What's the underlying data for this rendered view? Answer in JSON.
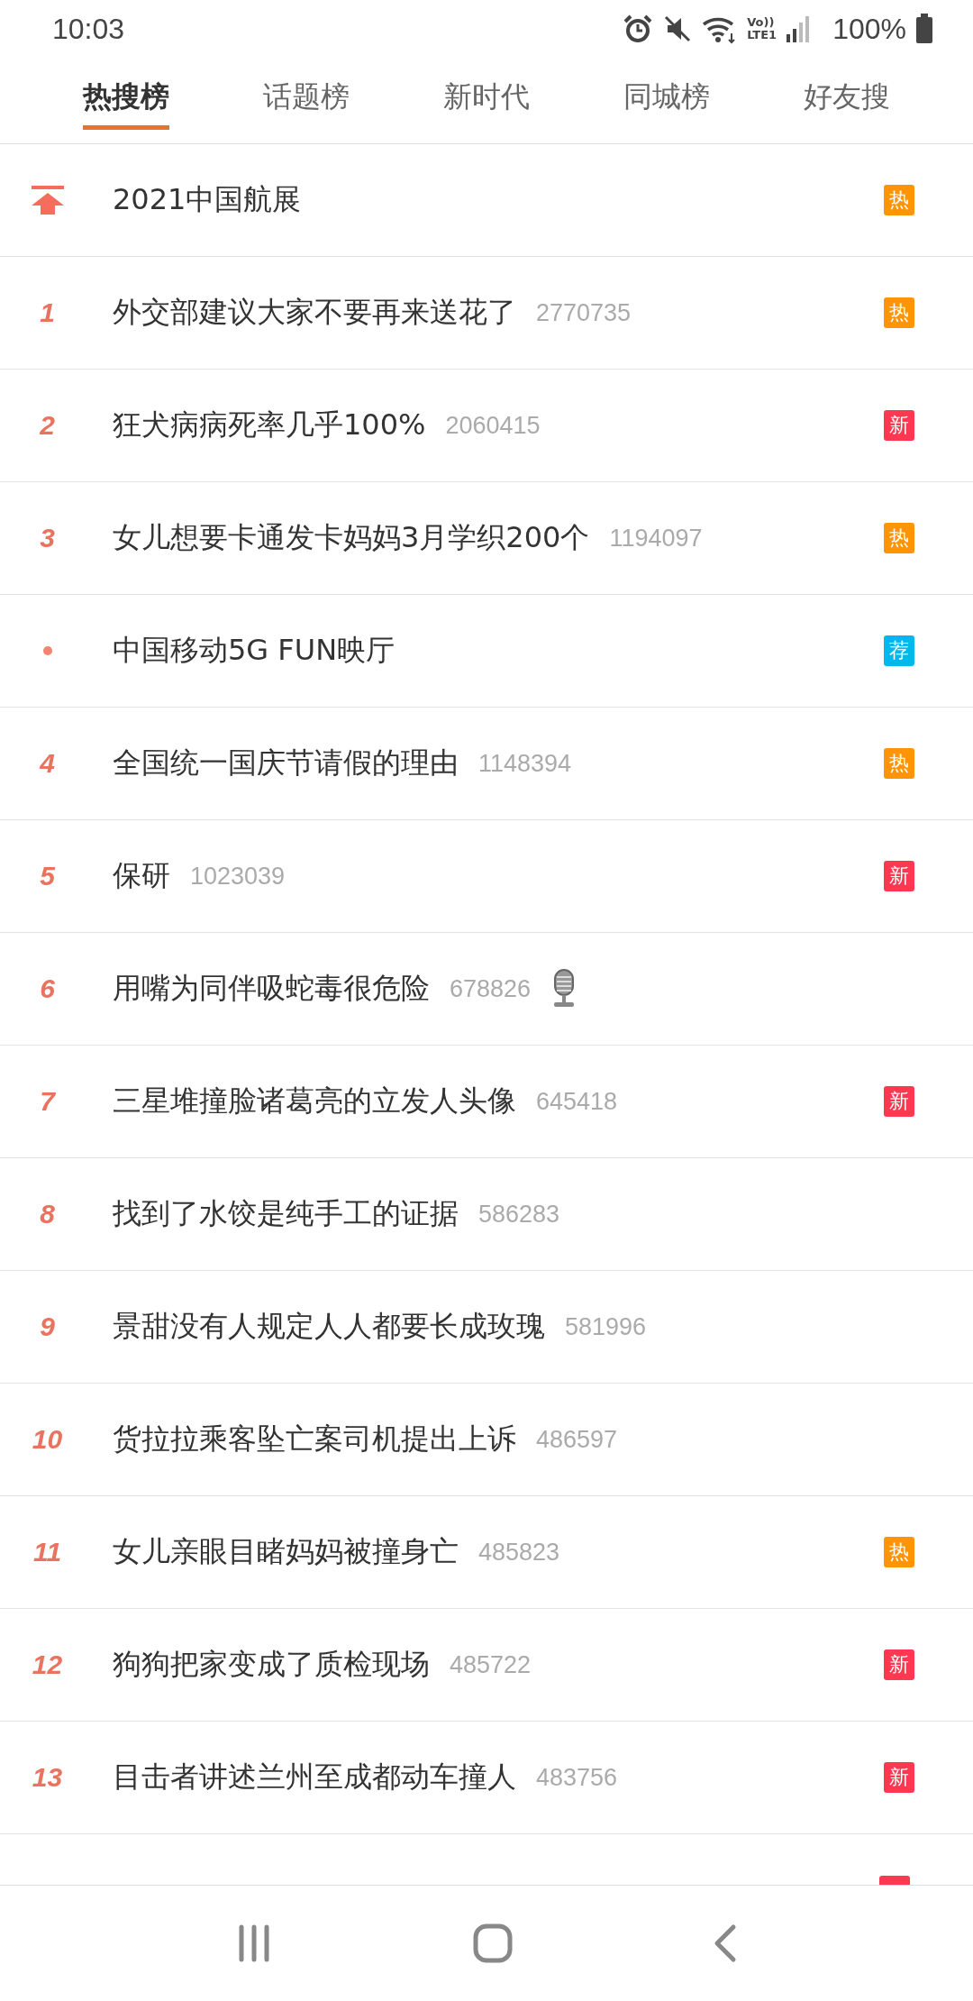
{
  "status_bar": {
    "time": "10:03",
    "network_labels": [
      "Vo))",
      "LTE1"
    ],
    "battery": "100%"
  },
  "tabs": [
    {
      "label": "热搜榜",
      "selected": true
    },
    {
      "label": "话题榜",
      "selected": false
    },
    {
      "label": "新时代",
      "selected": false
    },
    {
      "label": "同城榜",
      "selected": false
    },
    {
      "label": "好友搜",
      "selected": false
    }
  ],
  "rows": [
    {
      "kind": "pinned",
      "title": "2021中国航展",
      "badge": {
        "text": "热",
        "color": "#ff9406"
      },
      "mic": false
    },
    {
      "kind": "ranked",
      "rank": "1",
      "title": "外交部建议大家不要再来送花了",
      "count": "2770735",
      "badge": {
        "text": "热",
        "color": "#ff9406"
      },
      "mic": false
    },
    {
      "kind": "ranked",
      "rank": "2",
      "title": "狂犬病病死率几乎100%",
      "count": "2060415",
      "badge": {
        "text": "新",
        "color": "#ff3852"
      },
      "mic": false
    },
    {
      "kind": "ranked",
      "rank": "3",
      "title": "女儿想要卡通发卡妈妈3月学织200个",
      "count": "1194097",
      "badge": {
        "text": "热",
        "color": "#ff9406"
      },
      "mic": false
    },
    {
      "kind": "promoted",
      "title": "中国移动5G FUN映厅",
      "badge": {
        "text": "荐",
        "color": "#00b7ee"
      },
      "mic": false
    },
    {
      "kind": "ranked",
      "rank": "4",
      "title": "全国统一国庆节请假的理由",
      "count": "1148394",
      "badge": {
        "text": "热",
        "color": "#ff9406"
      },
      "mic": false
    },
    {
      "kind": "ranked",
      "rank": "5",
      "title": "保研",
      "count": "1023039",
      "badge": {
        "text": "新",
        "color": "#ff3852"
      },
      "mic": false
    },
    {
      "kind": "ranked",
      "rank": "6",
      "title": "用嘴为同伴吸蛇毒很危险",
      "count": "678826",
      "mic": true
    },
    {
      "kind": "ranked",
      "rank": "7",
      "title": "三星堆撞脸诸葛亮的立发人头像",
      "count": "645418",
      "badge": {
        "text": "新",
        "color": "#ff3852"
      },
      "mic": false
    },
    {
      "kind": "ranked",
      "rank": "8",
      "title": "找到了水饺是纯手工的证据",
      "count": "586283",
      "mic": false
    },
    {
      "kind": "ranked",
      "rank": "9",
      "title": "景甜没有人规定人人都要长成玫瑰",
      "count": "581996",
      "mic": false
    },
    {
      "kind": "ranked",
      "rank": "10",
      "title": "货拉拉乘客坠亡案司机提出上诉",
      "count": "486597",
      "mic": false
    },
    {
      "kind": "ranked",
      "rank": "11",
      "title": "女儿亲眼目睹妈妈被撞身亡",
      "count": "485823",
      "badge": {
        "text": "热",
        "color": "#ff9406"
      },
      "mic": false
    },
    {
      "kind": "ranked",
      "rank": "12",
      "title": "狗狗把家变成了质检现场",
      "count": "485722",
      "badge": {
        "text": "新",
        "color": "#ff3852"
      },
      "mic": false
    },
    {
      "kind": "ranked",
      "rank": "13",
      "title": "目击者讲述兰州至成都动车撞人",
      "count": "483756",
      "badge": {
        "text": "新",
        "color": "#ff3852"
      },
      "mic": false
    }
  ]
}
